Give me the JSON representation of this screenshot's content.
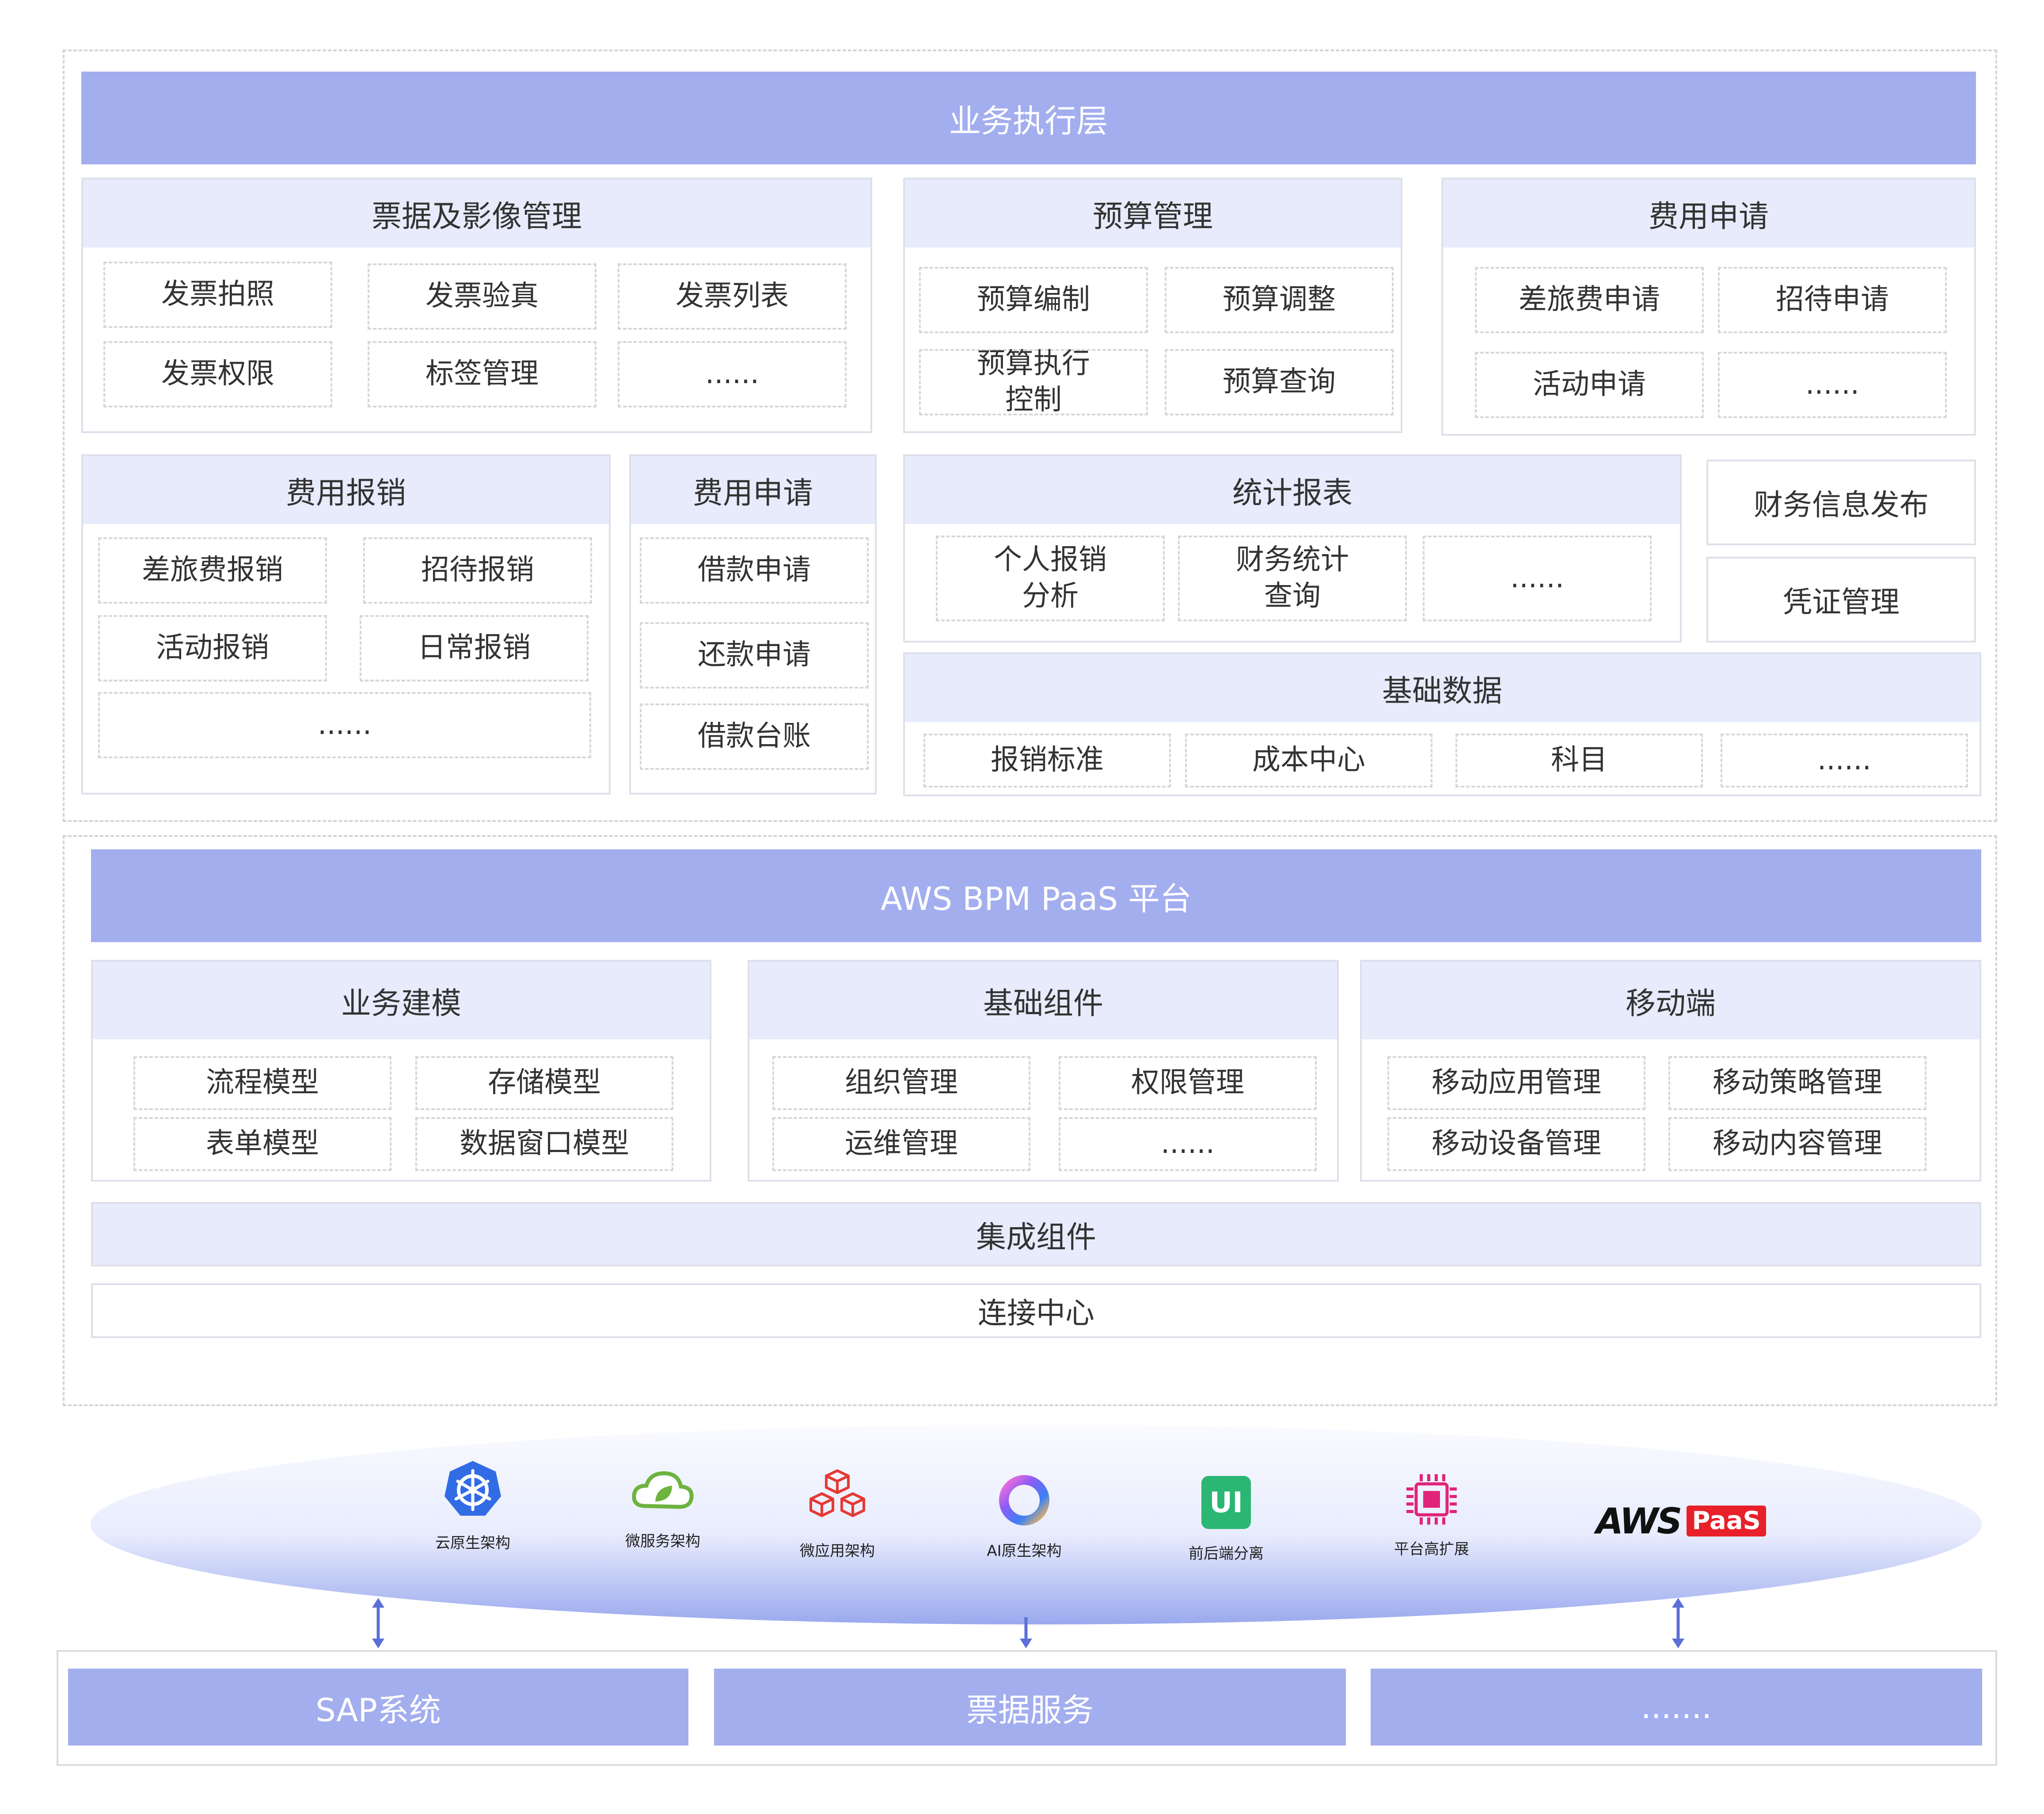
{
  "exec": {
    "title": "业务执行层",
    "bills": {
      "title": "票据及影像管理",
      "items": [
        "发票拍照",
        "发票验真",
        "发票列表",
        "发票权限",
        "标签管理",
        "......"
      ]
    },
    "budget": {
      "title": "预算管理",
      "items": [
        "预算编制",
        "预算调整",
        "预算执行控制",
        "预算查询"
      ]
    },
    "apply": {
      "title": "费用申请",
      "items": [
        "差旅费申请",
        "招待申请",
        "活动申请",
        "......"
      ]
    },
    "reimb": {
      "title": "费用报销",
      "items": [
        "差旅费报销",
        "招待报销",
        "活动报销",
        "日常报销",
        "......"
      ]
    },
    "loan": {
      "title": "费用申请",
      "items": [
        "借款申请",
        "还款申请",
        "借款台账"
      ]
    },
    "stats": {
      "title": "统计报表",
      "items": [
        "个人报销分析",
        "财务统计查询",
        "......"
      ]
    },
    "finance_release": "财务信息发布",
    "voucher": "凭证管理",
    "basic": {
      "title": "基础数据",
      "items": [
        "报销标准",
        "成本中心",
        "科目",
        "......"
      ]
    }
  },
  "platform": {
    "title": "AWS BPM PaaS 平台",
    "modeling": {
      "title": "业务建模",
      "items": [
        "流程模型",
        "存储模型",
        "表单模型",
        "数据窗口模型"
      ]
    },
    "components": {
      "title": "基础组件",
      "items": [
        "组织管理",
        "权限管理",
        "运维管理",
        "......"
      ]
    },
    "mobile": {
      "title": "移动端",
      "items": [
        "移动应用管理",
        "移动策略管理",
        "移动设备管理",
        "移动内容管理"
      ]
    },
    "integration": "集成组件",
    "connector": "连接中心"
  },
  "tech": {
    "items": [
      {
        "label": "云原生架构",
        "icon": "kubernetes-icon"
      },
      {
        "label": "微服务架构",
        "icon": "cloud-leaf-icon"
      },
      {
        "label": "微应用架构",
        "icon": "cubes-icon"
      },
      {
        "label": "AI原生架构",
        "icon": "ai-ring-icon"
      },
      {
        "label": "前后端分离",
        "icon": "ui-icon"
      },
      {
        "label": "平台高扩展",
        "icon": "chip-icon"
      }
    ],
    "logo_text": "AWS",
    "logo_badge": "PaaS",
    "colors": {
      "k8s": "#326ce5",
      "cloud": "#6db33f",
      "cubes": "#e53935",
      "ui": "#2bb673",
      "chip": "#e0247a",
      "paas": "#e8202a"
    }
  },
  "external": {
    "items": [
      "SAP系统",
      "票据服务",
      "......."
    ]
  },
  "colors": {
    "banner": "#a3aeee",
    "header": "#e8ebfb",
    "arrow": "#5b6fd8"
  }
}
